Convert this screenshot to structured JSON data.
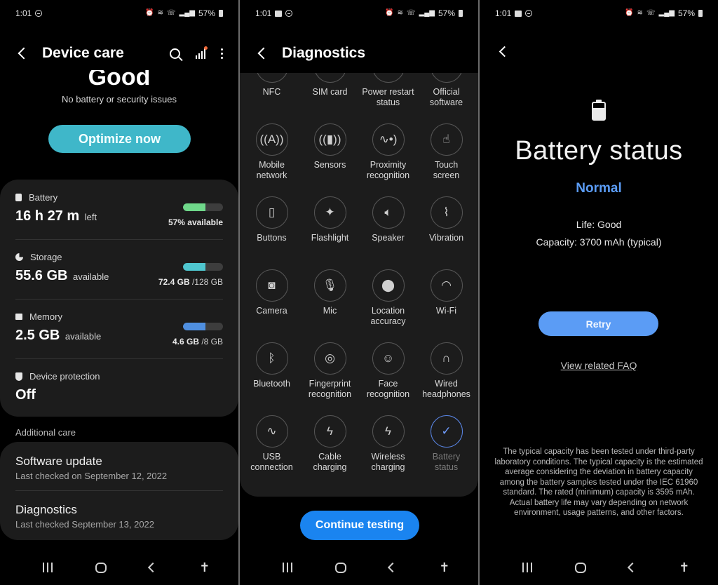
{
  "status_bar": {
    "time": "1:01",
    "battery_percent": "57%"
  },
  "colors": {
    "battery_bar": "#6fd88a",
    "storage_bar": "#4fc6cf",
    "memory_bar": "#4f8fe0",
    "optimize_button": "#3fb7c9",
    "continue_button": "#1a84f0",
    "retry_button": "#5b9cf5",
    "status_normal": "#5b9cf5"
  },
  "device_care": {
    "title": "Device care",
    "status_word": "Good",
    "subtitle": "No battery or security issues",
    "optimize_label": "Optimize now",
    "metrics": [
      {
        "label": "Battery",
        "value": "16 h 27 m",
        "unit": "left",
        "detail_bold": "57% available",
        "detail_rest": "",
        "fill_percent": 57
      },
      {
        "label": "Storage",
        "value": "55.6 GB",
        "unit": "available",
        "detail_bold": "72.4 GB",
        "detail_rest": " /128 GB",
        "fill_percent": 57
      },
      {
        "label": "Memory",
        "value": "2.5 GB",
        "unit": "available",
        "detail_bold": "4.6 GB",
        "detail_rest": " /8 GB",
        "fill_percent": 57
      },
      {
        "label": "Device protection",
        "value": "Off",
        "unit": ""
      }
    ],
    "additional_care_label": "Additional care",
    "additional_items": [
      {
        "title": "Software update",
        "subtitle": "Last checked on September 12, 2022"
      },
      {
        "title": "Diagnostics",
        "subtitle": "Last checked September 13, 2022"
      }
    ]
  },
  "diagnostics": {
    "title": "Diagnostics",
    "tests": [
      {
        "label": "NFC",
        "icon": "nfc-icon",
        "glyph": "N"
      },
      {
        "label": "SIM card",
        "icon": "sim-card-icon",
        "glyph": "▦"
      },
      {
        "label": "Power restart\nstatus",
        "icon": "power-restart-icon",
        "glyph": "↻"
      },
      {
        "label": "Official\nsoftware",
        "icon": "official-badge-icon",
        "glyph": "✪"
      },
      {
        "label": "Mobile\nnetwork",
        "icon": "antenna-icon",
        "glyph": "((A))"
      },
      {
        "label": "Sensors",
        "icon": "sensors-icon",
        "glyph": "((▮))"
      },
      {
        "label": "Proximity\nrecognition",
        "icon": "proximity-icon",
        "glyph": "∿•)"
      },
      {
        "label": "Touch\nscreen",
        "icon": "touch-icon",
        "glyph": "☝"
      },
      {
        "label": "Buttons",
        "icon": "phone-buttons-icon",
        "glyph": "▯"
      },
      {
        "label": "Flashlight",
        "icon": "flashlight-icon",
        "glyph": "✦"
      },
      {
        "label": "Speaker",
        "icon": "speaker-icon",
        "glyph": "🔈︎"
      },
      {
        "label": "Vibration",
        "icon": "vibration-icon",
        "glyph": "⌇"
      },
      {
        "label": "Camera",
        "icon": "camera-icon",
        "glyph": "◙"
      },
      {
        "label": "Mic",
        "icon": "mic-icon",
        "glyph": "🎙︎"
      },
      {
        "label": "Location\naccuracy",
        "icon": "location-pin-icon",
        "glyph": "⬤"
      },
      {
        "label": "Wi-Fi",
        "icon": "wifi-icon",
        "glyph": "◠"
      },
      {
        "label": "Bluetooth",
        "icon": "bluetooth-icon",
        "glyph": "ᛒ"
      },
      {
        "label": "Fingerprint\nrecognition",
        "icon": "fingerprint-icon",
        "glyph": "◎"
      },
      {
        "label": "Face\nrecognition",
        "icon": "face-icon",
        "glyph": "☺"
      },
      {
        "label": "Wired\nheadphones",
        "icon": "headphones-icon",
        "glyph": "∩"
      },
      {
        "label": "USB\nconnection",
        "icon": "usb-icon",
        "glyph": "∿"
      },
      {
        "label": "Cable\ncharging",
        "icon": "cable-charging-icon",
        "glyph": "ϟ"
      },
      {
        "label": "Wireless\ncharging",
        "icon": "wireless-charging-icon",
        "glyph": "ϟ"
      },
      {
        "label": "Battery\nstatus",
        "icon": "checkmark-icon",
        "glyph": "✓",
        "done": true
      }
    ],
    "continue_label": "Continue testing"
  },
  "battery_status": {
    "title": "Battery status",
    "state": "Normal",
    "life": "Life: Good",
    "capacity": "Capacity: 3700 mAh (typical)",
    "retry_label": "Retry",
    "faq_label": "View related FAQ",
    "fine_print": "The typical capacity has been tested under third-party laboratory conditions. The typical capacity is the estimated average considering the deviation in battery capacity among the battery samples tested under the IEC 61960 standard. The rated (minimum) capacity is 3595 mAh. Actual battery life may vary depending on network environment, usage patterns, and other factors."
  }
}
